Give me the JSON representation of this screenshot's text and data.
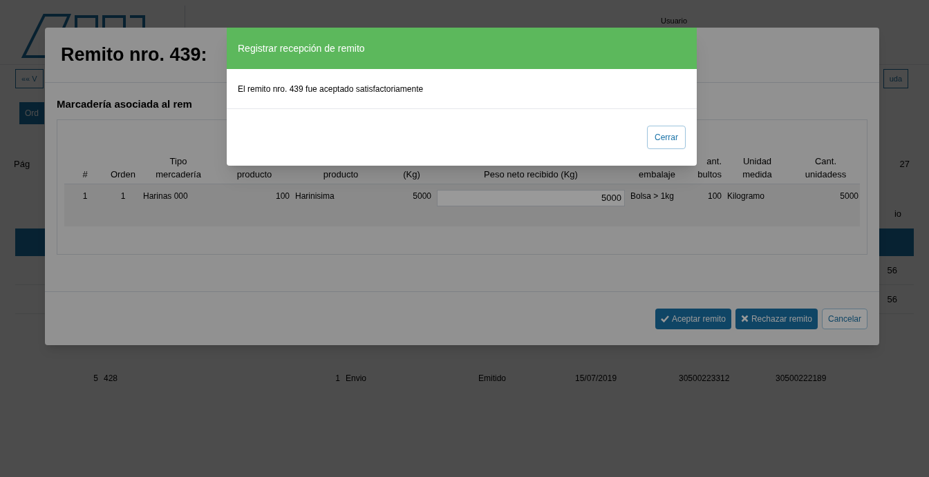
{
  "page": {
    "user_label": "Usuario",
    "back_button": "«« V",
    "help_button": "uda",
    "tab_button": "Ord",
    "pager_label": "Pág",
    "pager_count": "27",
    "column_fragment": "io",
    "row_fragments": [
      "56",
      "56"
    ],
    "visible_row": [
      "5",
      "428",
      "1",
      "Envio",
      "Emitido",
      "15/07/2019",
      "30500223312",
      "30500222189"
    ]
  },
  "modal": {
    "title": "Remito nro. 439:",
    "section_title": "Marcadería asociada al rem",
    "columns": [
      {
        "line2": "#"
      },
      {
        "line2": "Orden"
      },
      {
        "line1": "Tipo",
        "line2": "mercadería"
      },
      {
        "line2": "producto"
      },
      {
        "line2": "producto"
      },
      {
        "line2": "(Kg)"
      },
      {
        "line2": "Peso neto recibido (Kg)"
      },
      {
        "line2": "embalaje"
      },
      {
        "line1": "ant.",
        "line2": "bultos"
      },
      {
        "line1": "Unidad",
        "line2": "medida"
      },
      {
        "line1": "Cant.",
        "line2": "unidadess"
      }
    ],
    "rows": [
      {
        "cells": [
          "1",
          "1",
          "Harinas 000",
          "100",
          "Harinisima",
          "5000",
          "5000",
          "Bolsa > 1kg",
          "100",
          "Kilogramo",
          "5000"
        ]
      }
    ],
    "buttons": [
      {
        "kind": "accept",
        "label": "Aceptar remito"
      },
      {
        "kind": "reject",
        "label": "Rechazar remito"
      },
      {
        "kind": "cancel",
        "label": "Cancelar"
      }
    ]
  },
  "dialog": {
    "title": "Registrar recepción de remito",
    "message": "El remito nro. 439 fue aceptado satisfactoriamente",
    "button": "Cerrar"
  }
}
